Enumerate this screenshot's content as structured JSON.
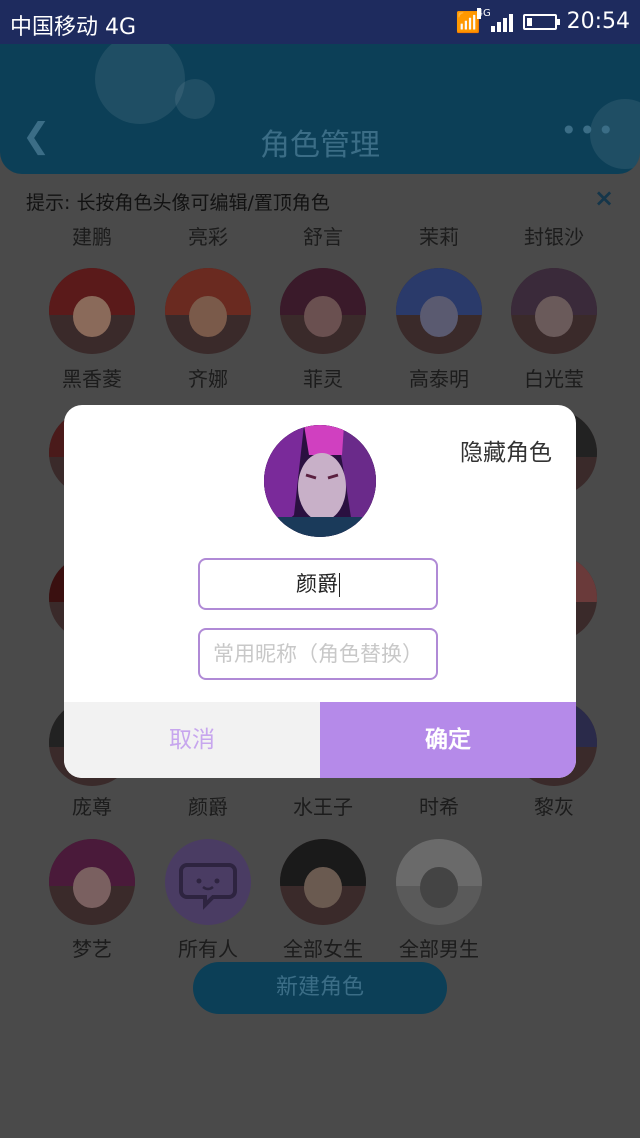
{
  "status_bar": {
    "carrier": "中国移动 4G",
    "network": "4G",
    "time": "20:54"
  },
  "header": {
    "title": "角色管理",
    "back_icon": "back-arrow-icon",
    "more_icon": "more-dots-icon"
  },
  "tip": {
    "text": "提示: 长按角色头像可编辑/置顶角色",
    "close_symbol": "×"
  },
  "top_names": [
    "建鹏",
    "亮彩",
    "舒言",
    "茉莉",
    "封银沙"
  ],
  "rows": [
    [
      "黑香菱",
      "齐娜",
      "菲灵",
      "高泰明",
      "白光莹"
    ],
    [
      "庞尊",
      "颜爵",
      "水王子",
      "时希",
      "黎灰"
    ],
    [
      "梦艺",
      "所有人",
      "全部女生",
      "全部男生"
    ]
  ],
  "new_button": "新建角色",
  "dialog": {
    "hide_label": "隐藏角色",
    "name_value": "颜爵",
    "nickname_placeholder": "常用昵称（角色替换）",
    "cancel_label": "取消",
    "confirm_label": "确定"
  },
  "colors": {
    "accent": "#b58ae9",
    "header": "#0c3f57",
    "status_bar": "#1e2b5e"
  }
}
